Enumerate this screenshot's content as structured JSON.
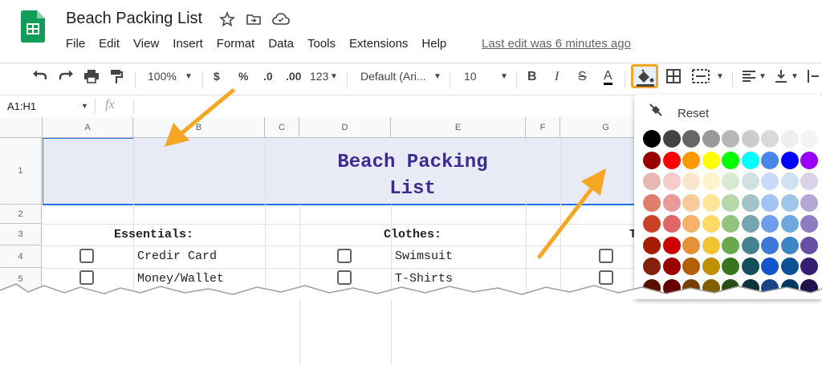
{
  "app": {
    "title": "Beach Packing List",
    "last_edit": "Last edit was 6 minutes ago",
    "menu": [
      "File",
      "Edit",
      "View",
      "Insert",
      "Format",
      "Data",
      "Tools",
      "Extensions",
      "Help"
    ]
  },
  "toolbar": {
    "zoom": "100%",
    "currency": "$",
    "percent": "%",
    "dec_decrease": ".0",
    "dec_increase": ".00",
    "more_formats": "123",
    "font": "Default (Ari...",
    "font_size": "10",
    "bold": "B",
    "italic": "I",
    "strike": "S",
    "text_color": "A"
  },
  "formula_bar": {
    "range": "A1:H1",
    "fx": "fx"
  },
  "columns": [
    "A",
    "B",
    "C",
    "D",
    "E",
    "F",
    "G"
  ],
  "rows": [
    "1",
    "2",
    "3",
    "4",
    "5"
  ],
  "sheet": {
    "title_line1": "Beach Packing",
    "title_line2": "List",
    "essentials_header": "Essentials:",
    "clothes_header": "Clothes:",
    "partial_header": "T",
    "essentials": [
      "Credir Card",
      "Money/Wallet"
    ],
    "clothes": [
      "Swimsuit",
      "T-Shirts"
    ]
  },
  "palette": {
    "reset_label": "Reset",
    "rows": [
      [
        "#000000",
        "#434343",
        "#666666",
        "#999999",
        "#b7b7b7",
        "#cccccc",
        "#d9d9d9",
        "#efefef",
        "#f3f3f3"
      ],
      [
        "#980000",
        "#ff0000",
        "#ff9900",
        "#ffff00",
        "#00ff00",
        "#00ffff",
        "#4a86e8",
        "#0000ff",
        "#9900ff"
      ],
      [
        "#e6b8af",
        "#f4cccc",
        "#fce5cd",
        "#fff2cc",
        "#d9ead3",
        "#d0e0e3",
        "#c9daf8",
        "#cfe2f3",
        "#d9d2e9"
      ],
      [
        "#dd7e6b",
        "#ea9999",
        "#f9cb9c",
        "#ffe599",
        "#b6d7a8",
        "#a2c4c9",
        "#a4c2f4",
        "#9fc5e8",
        "#b4a7d6"
      ],
      [
        "#cc4125",
        "#e06666",
        "#f6b26b",
        "#ffd966",
        "#93c47d",
        "#76a5af",
        "#6d9eeb",
        "#6fa8dc",
        "#8e7cc3"
      ],
      [
        "#a61c00",
        "#cc0000",
        "#e69138",
        "#f1c232",
        "#6aa84f",
        "#45818e",
        "#3c78d8",
        "#3d85c6",
        "#674ea7"
      ],
      [
        "#85200c",
        "#990000",
        "#b45f06",
        "#bf9000",
        "#38761d",
        "#134f5c",
        "#1155cc",
        "#0b5394",
        "#351c75"
      ],
      [
        "#5b0f00",
        "#660000",
        "#783f04",
        "#7f6000",
        "#274e13",
        "#0c343d",
        "#1c4587",
        "#073763",
        "#20124d"
      ]
    ]
  },
  "accent": {
    "arrow": "#f5a623",
    "selection": "#1a73e8",
    "sheets_green": "#0f9d58",
    "title_text": "#3d2c8d"
  }
}
